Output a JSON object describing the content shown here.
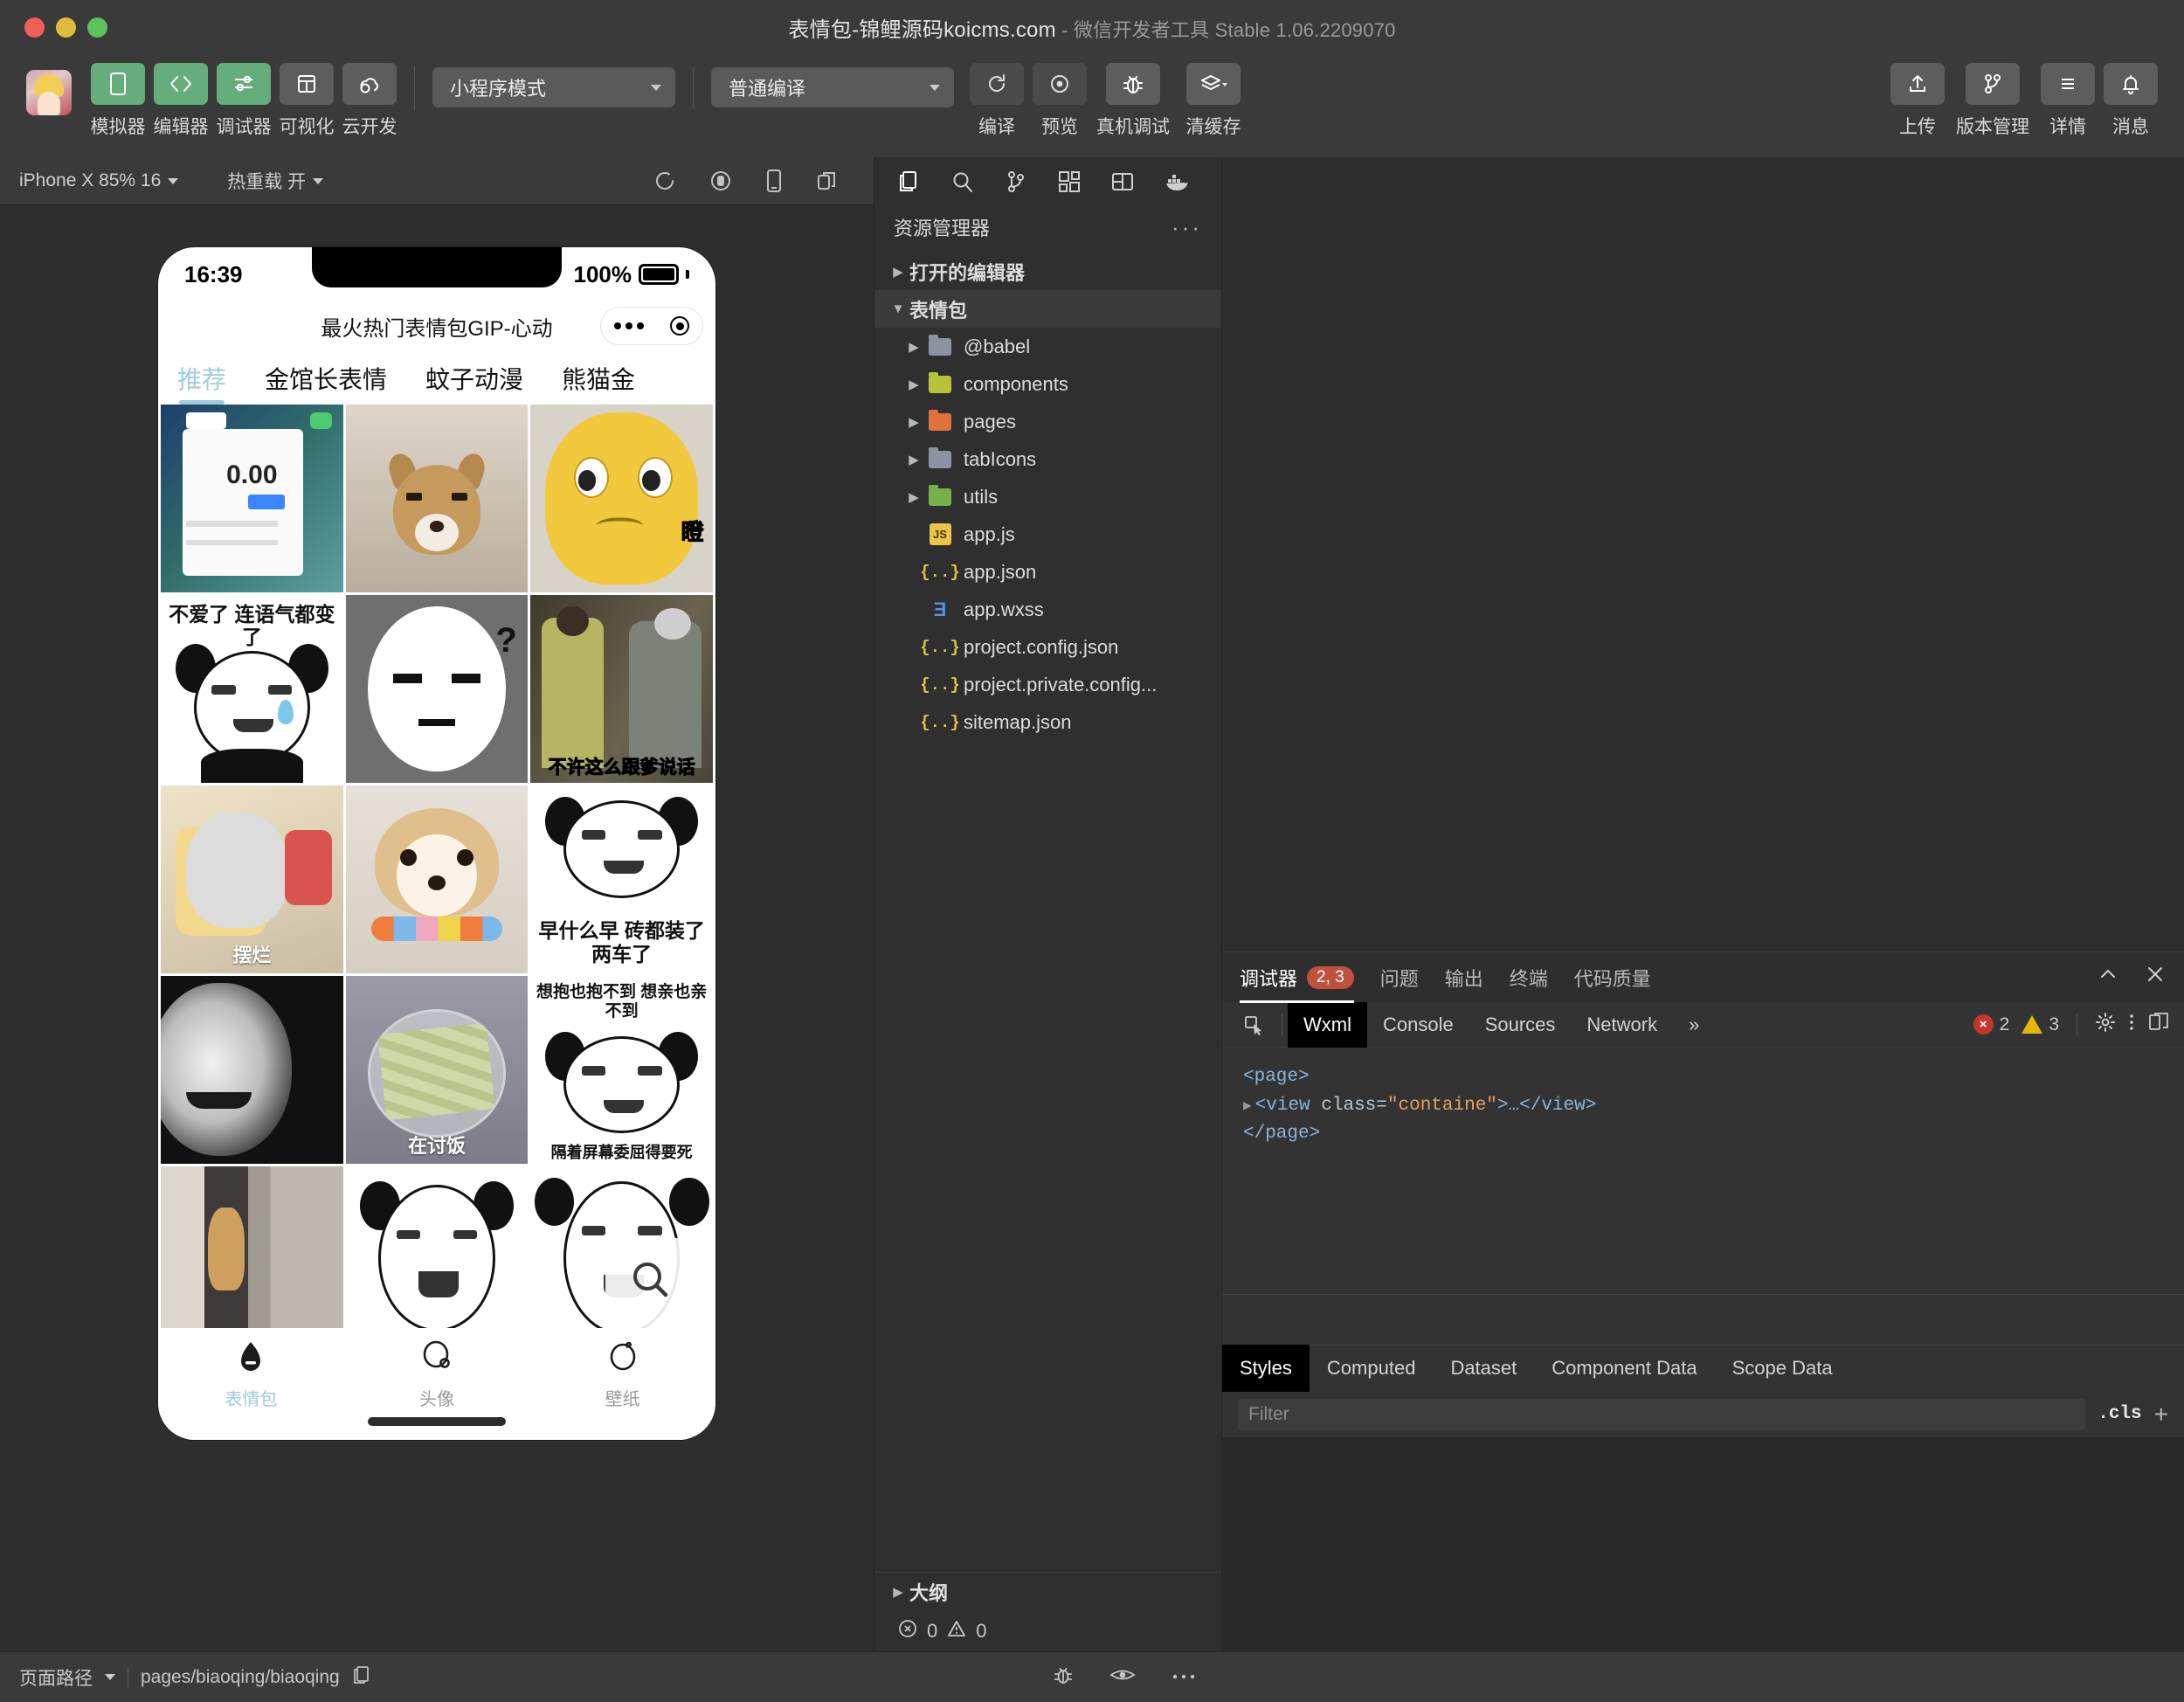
{
  "window": {
    "title_main": "表情包-锦鲤源码koicms.com",
    "title_sub": " - 微信开发者工具 Stable 1.06.2209070",
    "traffic": [
      "close-button",
      "minimize-button",
      "maximize-button"
    ]
  },
  "toolbar": {
    "items": [
      {
        "label": "模拟器",
        "icon": "simulator-icon",
        "style": "green"
      },
      {
        "label": "编辑器",
        "icon": "editor-icon",
        "style": "green"
      },
      {
        "label": "调试器",
        "icon": "debugger-icon",
        "style": "green"
      },
      {
        "label": "可视化",
        "icon": "visualizer-icon",
        "style": "grey"
      },
      {
        "label": "云开发",
        "icon": "cloud-icon",
        "style": "grey"
      }
    ],
    "mode_select": "小程序模式",
    "compile_select": "普通编译",
    "actions": [
      {
        "label": "编译",
        "icon": "refresh-icon"
      },
      {
        "label": "预览",
        "icon": "preview-eye-icon"
      },
      {
        "label": "真机调试",
        "icon": "bug-icon"
      },
      {
        "label": "清缓存",
        "icon": "layers-icon"
      }
    ],
    "right_actions": [
      {
        "label": "上传",
        "icon": "upload-icon"
      },
      {
        "label": "版本管理",
        "icon": "branch-icon"
      },
      {
        "label": "详情",
        "icon": "details-icon"
      },
      {
        "label": "消息",
        "icon": "bell-icon"
      }
    ]
  },
  "simulator": {
    "device_select": "iPhone X 85% 16",
    "hotreload_select": "热重载 开",
    "icons": [
      "refresh-icon",
      "record-icon",
      "rotate-device-icon",
      "multi-window-icon"
    ],
    "phone": {
      "status_time": "16:39",
      "battery_percent": "100%",
      "nav_title": "最火热门表情包GIP-心动",
      "categories": [
        {
          "label": "推荐",
          "active": true
        },
        {
          "label": "金馆长表情",
          "active": false
        },
        {
          "label": "蚊子动漫",
          "active": false
        },
        {
          "label": "熊猫金",
          "active": false
        }
      ],
      "grid": [
        {
          "art": "m-wallet",
          "caption": "",
          "sub": "0.00",
          "name": "meme-wallet"
        },
        {
          "art": "m-shiba1",
          "caption": "",
          "name": "meme-shiba-stare"
        },
        {
          "art": "m-yellow",
          "caption": "",
          "zi": "瞪",
          "name": "meme-yellow-blob"
        },
        {
          "art": "m-panda",
          "caption": "",
          "top": "不爱了 连语气都变了",
          "name": "meme-panda-tear"
        },
        {
          "art": "m-blank",
          "caption": "",
          "name": "meme-blank-face"
        },
        {
          "art": "m-drama",
          "caption": "不许这么跟爹说话",
          "name": "meme-drama-scene"
        },
        {
          "art": "m-cat1",
          "caption": "摆烂",
          "name": "meme-lazy-cat"
        },
        {
          "art": "m-shiba2",
          "caption": "",
          "name": "meme-happy-shiba"
        },
        {
          "art": "m-panda",
          "caption": "",
          "bottom": "早什么早\n砖都装了两车了",
          "name": "meme-panda-early"
        },
        {
          "art": "m-bw",
          "caption": "",
          "name": "meme-bw-face"
        },
        {
          "art": "m-money",
          "caption": "在讨饭",
          "name": "meme-money-bowl"
        },
        {
          "art": "m-panda",
          "caption": "",
          "top": "想抱也抱不到\n想亲也亲不到",
          "bottom": "隔着屏幕委屈得要死",
          "name": "meme-panda-miss"
        },
        {
          "art": "m-cat2",
          "caption": "",
          "name": "meme-peeking-cat"
        },
        {
          "art": "m-bw",
          "caption": "",
          "name": "meme-panda-laugh"
        },
        {
          "art": "m-panda2",
          "caption": "",
          "name": "meme-panda-blush"
        }
      ],
      "fab_icon": "search-icon",
      "tabbar": [
        {
          "label": "表情包",
          "icon": "sticker-icon",
          "active": true
        },
        {
          "label": "头像",
          "icon": "avatar-icon",
          "active": false
        },
        {
          "label": "壁纸",
          "icon": "wallpaper-icon",
          "active": false
        }
      ]
    }
  },
  "explorer": {
    "activity_icons": [
      "files-icon",
      "search-icon",
      "source-control-icon",
      "extensions-icon",
      "layout-icon",
      "docker-icon"
    ],
    "title": "资源管理器",
    "more": "···",
    "sections": [
      {
        "label": "打开的编辑器",
        "expanded": false
      },
      {
        "label": "表情包",
        "expanded": true
      }
    ],
    "files": [
      {
        "name": "@babel",
        "type": "folder",
        "color": "#8b93a3",
        "indent": 1,
        "arrow": true
      },
      {
        "name": "components",
        "type": "folder",
        "color": "#b5c23a",
        "indent": 1,
        "arrow": true
      },
      {
        "name": "pages",
        "type": "folder",
        "color": "#e0703c",
        "indent": 1,
        "arrow": true
      },
      {
        "name": "tabIcons",
        "type": "folder",
        "color": "#8b93a3",
        "indent": 1,
        "arrow": true
      },
      {
        "name": "utils",
        "type": "folder",
        "color": "#76b04a",
        "indent": 1,
        "arrow": true
      },
      {
        "name": "app.js",
        "type": "js",
        "indent": 1,
        "arrow": false
      },
      {
        "name": "app.json",
        "type": "json",
        "indent": 1,
        "arrow": false
      },
      {
        "name": "app.wxss",
        "type": "css",
        "indent": 1,
        "arrow": false
      },
      {
        "name": "project.config.json",
        "type": "json",
        "indent": 1,
        "arrow": false
      },
      {
        "name": "project.private.config...",
        "type": "json",
        "indent": 1,
        "arrow": false
      },
      {
        "name": "sitemap.json",
        "type": "json",
        "indent": 1,
        "arrow": false
      }
    ],
    "outline_label": "大纲",
    "problems": {
      "errors": "0",
      "warnings": "0"
    }
  },
  "debugger": {
    "tabs": [
      {
        "label": "调试器",
        "badge": "2, 3",
        "active": true
      },
      {
        "label": "问题",
        "badge": "",
        "active": false
      },
      {
        "label": "输出",
        "badge": "",
        "active": false
      },
      {
        "label": "终端",
        "badge": "",
        "active": false
      },
      {
        "label": "代码质量",
        "badge": "",
        "active": false
      }
    ],
    "panel_actions": [
      "collapse-icon",
      "close-icon"
    ],
    "devtools": {
      "picker_icon": "element-picker-icon",
      "tabs": [
        {
          "label": "Wxml",
          "active": true
        },
        {
          "label": "Console",
          "active": false
        },
        {
          "label": "Sources",
          "active": false
        },
        {
          "label": "Network",
          "active": false
        },
        {
          "label": "»",
          "active": false
        }
      ],
      "error_count": "2",
      "warning_count": "3",
      "right_icons": [
        "gear-icon",
        "kebab-menu-icon",
        "dock-icon"
      ],
      "code_lines": [
        {
          "indent": 0,
          "tri": false,
          "html": "page-open"
        },
        {
          "indent": 1,
          "tri": true,
          "html": "view-line"
        },
        {
          "indent": 0,
          "tri": false,
          "html": "page-close"
        }
      ],
      "code": {
        "l1": "<page>",
        "l2_tag": "<view ",
        "l2_attr": "class=",
        "l2_val": "\"containe\"",
        "l2_rest": ">…</view>",
        "l3": "</page>"
      },
      "subtabs": [
        {
          "label": "Styles",
          "active": true
        },
        {
          "label": "Computed",
          "active": false
        },
        {
          "label": "Dataset",
          "active": false
        },
        {
          "label": "Component Data",
          "active": false
        },
        {
          "label": "Scope Data",
          "active": false
        }
      ],
      "filter_placeholder": "Filter",
      "cls_label": ".cls",
      "plus_label": "+"
    }
  },
  "statusbar": {
    "page_path_label": "页面路径",
    "page_path_value": "pages/biaoqing/biaoqing",
    "copy_icon": "copy-icon",
    "icons": [
      "bug-icon",
      "eye-icon",
      "more-icon"
    ]
  },
  "colors": {
    "accent_green": "#66ad7c",
    "titlebar": "#3a3a3a",
    "background": "#2e2e2e",
    "panel": "#333333",
    "badge_red": "#c0513c",
    "phone_accent": "#9ecbe0"
  }
}
